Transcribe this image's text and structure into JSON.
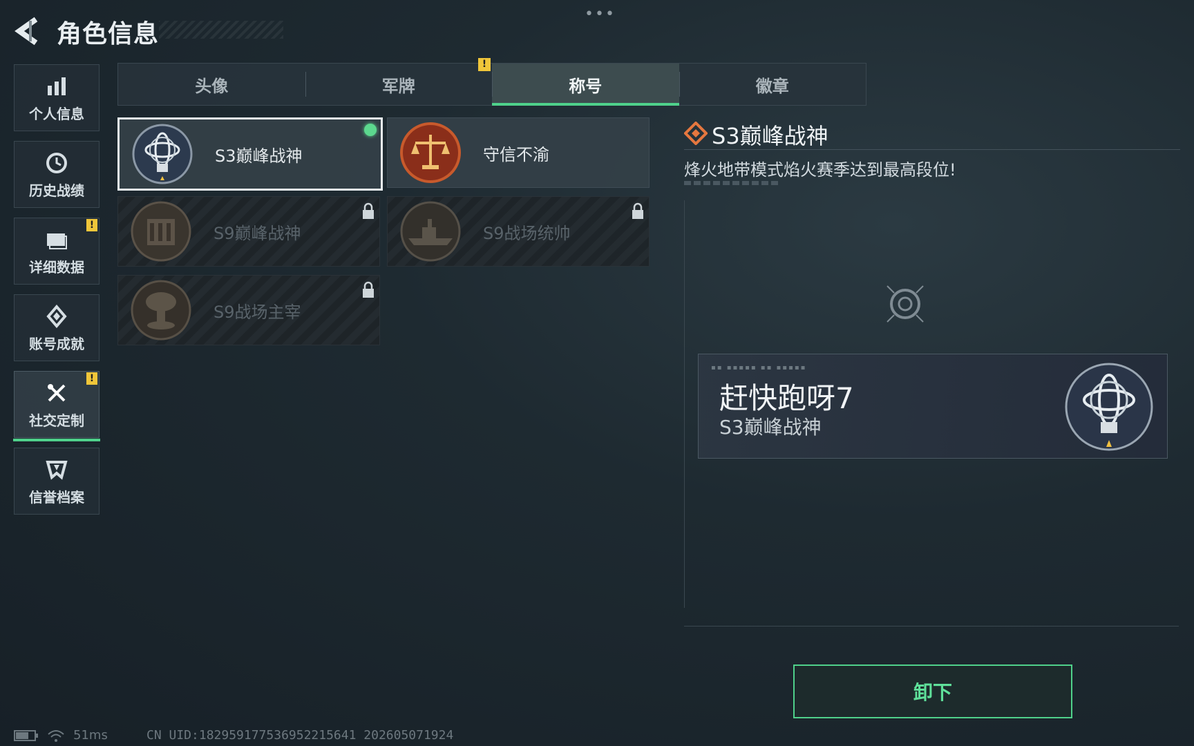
{
  "header": {
    "title": "角色信息",
    "back_icon": "back-arrow-icon",
    "more_icon": "more-dots-icon",
    "more_label": "•••"
  },
  "sidebar": {
    "items": [
      {
        "label": "个人信息",
        "icon": "bar-chart-icon",
        "warning": false,
        "active": false
      },
      {
        "label": "历史战绩",
        "icon": "history-clock-icon",
        "warning": false,
        "active": false
      },
      {
        "label": "详细数据",
        "icon": "folder-icon",
        "warning": true,
        "active": false
      },
      {
        "label": "账号成就",
        "icon": "achievement-icon",
        "warning": false,
        "active": false
      },
      {
        "label": "社交定制",
        "icon": "tools-icon",
        "warning": true,
        "active": true
      },
      {
        "label": "信誉档案",
        "icon": "credit-shield-icon",
        "warning": false,
        "active": false
      }
    ]
  },
  "tabs": {
    "items": [
      {
        "label": "头像",
        "active": false
      },
      {
        "label": "军牌",
        "active": false
      },
      {
        "label": "称号",
        "active": true
      },
      {
        "label": "徽章",
        "active": false
      }
    ],
    "warning_mark": "!"
  },
  "titles": {
    "items": [
      {
        "label": "S3巅峰战神",
        "locked": false,
        "selected": true,
        "equipped": true,
        "emblem": "armillary-sphere-emblem"
      },
      {
        "label": "守信不渝",
        "locked": false,
        "selected": false,
        "equipped": false,
        "emblem": "scales-emblem"
      },
      {
        "label": "S9巅峰战神",
        "locked": true,
        "selected": false,
        "equipped": false,
        "emblem": "building-emblem"
      },
      {
        "label": "S9战场统帅",
        "locked": true,
        "selected": false,
        "equipped": false,
        "emblem": "warship-emblem"
      },
      {
        "label": "S9战场主宰",
        "locked": true,
        "selected": false,
        "equipped": false,
        "emblem": "mushroom-cloud-emblem"
      }
    ]
  },
  "detail": {
    "title": "S3巅峰战神",
    "description": "烽火地带模式焰火赛季达到最高段位!"
  },
  "nameplate": {
    "player_name": "赶快跑呀7",
    "title": "S3巅峰战神"
  },
  "actions": {
    "unequip_label": "卸下"
  },
  "status_bar": {
    "latency": "51ms",
    "uid": "CN UID:18295917753695221564​1 202605071924"
  },
  "colors": {
    "accent_green": "#4fd18b",
    "warning_yellow": "#f0c63a",
    "background": "#1e2a31"
  }
}
